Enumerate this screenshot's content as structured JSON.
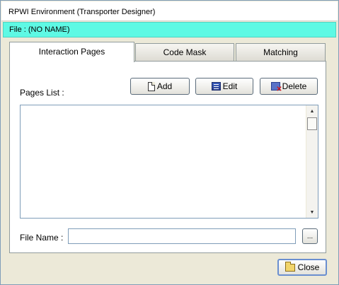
{
  "window": {
    "title": "RPWI Environment (Transporter Designer)",
    "file_label": "File : (NO NAME)"
  },
  "tabs": [
    {
      "label": "Interaction Pages",
      "active": true
    },
    {
      "label": "Code Mask",
      "active": false
    },
    {
      "label": "Matching",
      "active": false
    }
  ],
  "toolbar": {
    "add_label": "Add",
    "edit_label": "Edit",
    "delete_label": "Delete"
  },
  "pages_list": {
    "label": "Pages List :",
    "items": []
  },
  "file_name": {
    "label": "File Name :",
    "value": "",
    "browse_label": "..."
  },
  "close_label": "Close",
  "icons": {
    "add": "page-icon",
    "edit": "edit-icon",
    "delete": "delete-icon",
    "close": "folder-icon",
    "scroll_up": "arrow-up-icon",
    "scroll_down": "arrow-down-icon"
  },
  "colors": {
    "file_bar": "#5ef9e4",
    "window_bg": "#ece9d8"
  }
}
